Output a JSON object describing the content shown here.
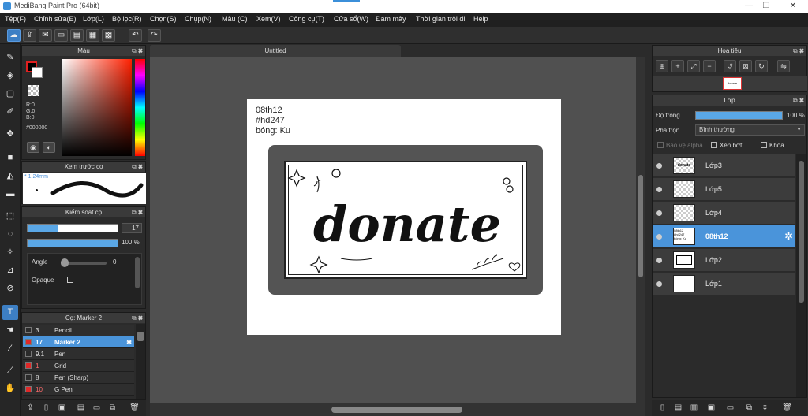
{
  "window": {
    "title": "MediBang Paint Pro (64bit)",
    "min": "—",
    "max": "❐",
    "close": "✕"
  },
  "menu": [
    "Tệp(F)",
    "Chỉnh sửa(E)",
    "Lớp(L)",
    "Bộ lọc(R)",
    "Chọn(S)",
    "Chụp(N)",
    "Màu (C)",
    "Xem(V)",
    "Công cụ(T)",
    "Cửa sổ(W)",
    "Đám mây",
    "Thời gian trôi đi",
    "Help"
  ],
  "toolbar_icons": [
    "cloud-icon",
    "share-icon",
    "comment-icon",
    "image-icon",
    "document-icon",
    "layout-icon",
    "grid-icon",
    "undo-icon",
    "redo-icon"
  ],
  "tools": [
    "brush-tool-icon",
    "eraser-tool-icon",
    "rectangle-tool-icon",
    "pen-snap-icon",
    "move-tool-icon",
    "shape-fill-icon",
    "bucket-tool-icon",
    "gradient-tool-icon",
    "select-rect-icon",
    "lasso-icon",
    "magic-wand-icon",
    "select-pen-icon",
    "select-eraser-icon",
    "text-tool-icon",
    "operation-icon",
    "eyedropper-icon",
    "divide-icon",
    "hand-icon"
  ],
  "color_panel": {
    "title": "Màu",
    "r": "R:0",
    "g": "G:0",
    "b": "B:0",
    "hex": "#000000",
    "fg": "#000000",
    "bg": "#ffffff"
  },
  "brush_preview": {
    "title": "Xem trước cọ",
    "size": "* 1.24mm"
  },
  "brush_control": {
    "title": "Kiểm soát cọ",
    "size": "17",
    "size_fraction": 0.33,
    "opacity": "100 %",
    "angle_label": "Angle",
    "angle_value": "0",
    "opaque_label": "Opaque"
  },
  "brush_list": {
    "title": "Cọ: Marker 2",
    "items": [
      {
        "num": "3",
        "name": "Pencil",
        "color": "#2b2b2b",
        "selected": false
      },
      {
        "num": "17",
        "name": "Marker 2",
        "color": "#e02828",
        "selected": true
      },
      {
        "num": "9.1",
        "name": "Pen",
        "color": "#2b2b2b",
        "selected": false
      },
      {
        "num": "1",
        "name": "Grid",
        "color": "#e02828",
        "selected": false
      },
      {
        "num": "8",
        "name": "Pen (Sharp)",
        "color": "#2b2b2b",
        "selected": false
      },
      {
        "num": "10",
        "name": "G Pen",
        "color": "#e02828",
        "selected": false
      }
    ]
  },
  "canvas": {
    "tab": "Untitled",
    "note_lines": [
      "08th12",
      "#hđ247",
      "bóng: Ku"
    ],
    "artwork_text": "donate"
  },
  "navigator": {
    "title": "Hoa tiêu",
    "thumb_text": "donate"
  },
  "layers": {
    "title": "Lớp",
    "opacity_label": "Độ trong",
    "opacity_value": "100 %",
    "blend_label": "Pha trộn",
    "blend_value": "Bình thường",
    "protect_alpha": "Bảo vệ alpha",
    "clipping": "Xén bớt",
    "lock": "Khóa",
    "items": [
      {
        "name": "Lớp3",
        "selected": false
      },
      {
        "name": "Lớp5",
        "selected": false
      },
      {
        "name": "Lớp4",
        "selected": false
      },
      {
        "name": "08th12",
        "selected": true
      },
      {
        "name": "Lớp2",
        "selected": false
      },
      {
        "name": "Lớp1",
        "selected": false
      }
    ],
    "thumb_note": "08th12\n#hđ247\nbóng: Ku"
  }
}
